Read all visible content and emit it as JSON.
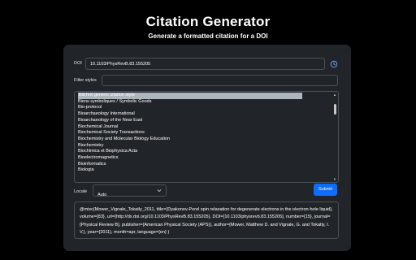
{
  "header": {
    "title": "Citation Generator",
    "subtitle": "Generate a formatted citation for a DOI"
  },
  "form": {
    "doi_label": "DOI",
    "doi_value": "10.1103/PhysRevB.83.155205",
    "history_icon": "clock-icon",
    "filter_label": "Filter styles",
    "filter_value": "",
    "styles": [
      {
        "label": "BibTeX generic citation style",
        "selected": true
      },
      {
        "label": "Biens symboliques / Symbolic Goods",
        "selected": false
      },
      {
        "label": "Bio-protocol",
        "selected": false
      },
      {
        "label": "Bioarchaeology International",
        "selected": false
      },
      {
        "label": "Bioarchaeology of the Near East",
        "selected": false
      },
      {
        "label": "Biochemical Journal",
        "selected": false
      },
      {
        "label": "Biochemical Society Transactions",
        "selected": false
      },
      {
        "label": "Biochemistry and Molecular Biology Education",
        "selected": false
      },
      {
        "label": "Biochemistry",
        "selected": false
      },
      {
        "label": "Biochimica et Biophysica Acta",
        "selected": false
      },
      {
        "label": "Bioelectromagnetics",
        "selected": false
      },
      {
        "label": "Bioinformatics",
        "selected": false
      },
      {
        "label": "Biologia",
        "selected": false
      }
    ],
    "locale_label": "Locale",
    "locale_value": "Auto",
    "submit_label": "Submit"
  },
  "output": {
    "citation": "@misc{Mower_Vignale_Tokatly_2011, title={Dyakonov-Perel spin relaxation for degenerate electrons in the electron-hole liquid}, volume={83}, url={http://dx.doi.org/10.1103/PhysRevB.83.155205}, DOI={10.1103/physrevb.83.155205}, number={15}, journal={Physical Review B}, publisher={American Physical Society (APS)}, author={Mower, Matthew D. and Vignale, G. and Tokatly, I. V.}, year={2011}, month=apr, language={en} }"
  },
  "colors": {
    "background": "#000000",
    "card": "#212529",
    "border": "#495057",
    "accent": "#0d6efd",
    "selected_option": "#adb5bd"
  }
}
